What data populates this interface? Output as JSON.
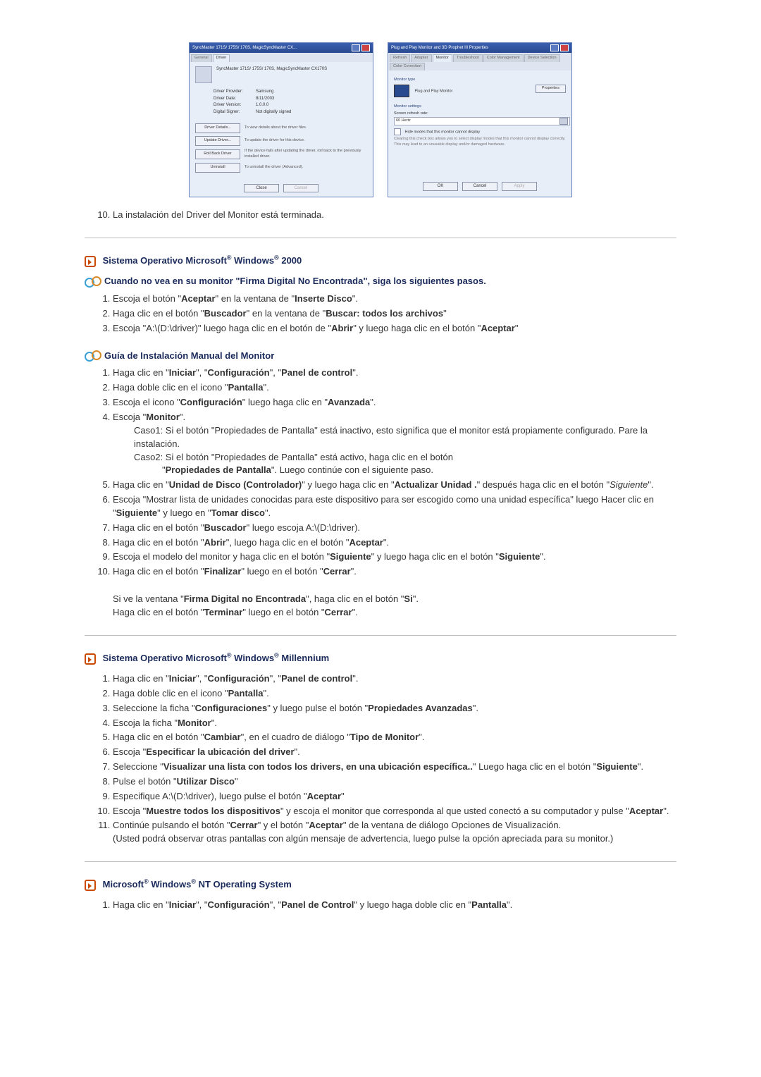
{
  "dialogs": {
    "driver": {
      "title": "SyncMaster 171S/ 175S/ 170S, MagicSyncMaster CX...",
      "tab_general": "General",
      "tab_driver": "Driver",
      "device_name": "SyncMaster 171S/ 175S/ 170S, MagicSyncMaster CX170S",
      "provider_label": "Driver Provider:",
      "provider_value": "Samsung",
      "date_label": "Driver Date:",
      "date_value": "8/11/2003",
      "version_label": "Driver Version:",
      "version_value": "1.0.0.0",
      "signer_label": "Digital Signer:",
      "signer_value": "Not digitally signed",
      "btn_details": "Driver Details...",
      "btn_details_desc": "To view details about the driver files.",
      "btn_update": "Update Driver...",
      "btn_update_desc": "To update the driver for this device.",
      "btn_rollback": "Roll Back Driver",
      "btn_rollback_desc": "If the device fails after updating the driver, roll back to the previously installed driver.",
      "btn_uninstall": "Uninstall",
      "btn_uninstall_desc": "To uninstall the driver (Advanced).",
      "footer_ok": "Close",
      "footer_cancel": "Cancel"
    },
    "pnp": {
      "title": "Plug and Play Monitor and 3D Prophet III Properties",
      "tabs": [
        "Refresh",
        "Adapter",
        "Monitor",
        "Troubleshoot",
        "Color Management",
        "Device Selection",
        "Color Correction"
      ],
      "section_type": "Monitor type",
      "monitor_name": "Plug and Play Monitor",
      "btn_properties": "Properties",
      "section_settings": "Monitor settings",
      "refresh_label": "Screen refresh rate:",
      "refresh_value": "60 Hertz",
      "chk_label": "Hide modes that this monitor cannot display",
      "note": "Clearing this check box allows you to select display modes that this monitor cannot display correctly. This may lead to an unusable display and/or damaged hardware.",
      "footer_ok": "OK",
      "footer_cancel": "Cancel",
      "footer_apply": "Apply"
    }
  },
  "step10": "La instalación del Driver del Monitor está terminada.",
  "sections": {
    "win2000": {
      "heading_pre": "Sistema Operativo Microsoft",
      "heading_mid": " Windows",
      "heading_post": " 2000",
      "sub1": "Cuando no vea en su monitor \"Firma Digital No Encontrada\", siga los siguientes pasos.",
      "s1_items": [
        "Escoja el botón \"<b>Aceptar</b>\" en la ventana de \"<b>Inserte Disco</b>\".",
        "Haga clic en el botón \"<b>Buscador</b>\" en la ventana de \"<b>Buscar: todos los archivos</b>\"",
        "Escoja \"A:\\(D:\\driver)\" luego haga clic en el botón de \"<b>Abrir</b>\" y luego haga clic en el botón \"<b>Aceptar</b>\""
      ],
      "sub2": "Guía de Instalación Manual del Monitor",
      "s2_items": [
        "Haga clic en \"<b>Iniciar</b>\", \"<b>Configuración</b>\", \"<b>Panel de control</b>\".",
        "Haga doble clic en el icono \"<b>Pantalla</b>\".",
        "Escoja el icono \"<b>Configuración</b>\" luego haga clic en \"<b>Avanzada</b>\".",
        "Escoja \"<b>Monitor</b>\".",
        "Haga clic en \"<b>Unidad de Disco (Controlador)</b>\" y luego haga clic en \"<b>Actualizar Unidad .</b>\" después haga clic en el botón \"<i>Siguiente</i>\".",
        "Escoja \"Mostrar lista de unidades conocidas para este dispositivo para ser escogido como una unidad específica\" luego Hacer clic en \"<b>Siguiente</b>\" y luego en \"<b>Tomar disco</b>\".",
        "Haga clic en el botón \"<b>Buscador</b>\" luego escoja A:\\(D:\\driver).",
        "Haga clic en el botón \"<b>Abrir</b>\", luego haga clic en el botón \"<b>Aceptar</b>\".",
        "Escoja el modelo del monitor y haga clic en el botón \"<b>Siguiente</b>\" y luego haga clic en el botón \"<b>Siguiente</b>\".",
        "Haga clic en el botón \"<b>Finalizar</b>\" luego en el botón \"<b>Cerrar</b>\"."
      ],
      "case1": "Caso1: Si el botón \"Propiedades de Pantalla\" está inactivo, esto significa que el monitor está propiamente configurado. Pare la instalación.",
      "case2_a": "Caso2: Si el botón \"Propiedades de Pantalla\" está activo, haga clic en el botón",
      "case2_b": "\"<b>Propiedades de Pantalla</b>\". Luego continúe con el siguiente paso.",
      "tail1": "Si ve la ventana \"<b>Firma Digital no Encontrada</b>\", haga clic en el botón \"<b>Si</b>\".",
      "tail2": "Haga clic en el botón \"<b>Terminar</b>\" luego en el botón \"<b>Cerrar</b>\"."
    },
    "winme": {
      "heading_pre": "Sistema Operativo Microsoft",
      "heading_mid": " Windows",
      "heading_post": " Millennium",
      "items": [
        "Haga clic en \"<b>Iniciar</b>\", \"<b>Configuración</b>\", \"<b>Panel de control</b>\".",
        "Haga doble clic en el icono \"<b>Pantalla</b>\".",
        "Seleccione la ficha \"<b>Configuraciones</b>\" y luego pulse el botón \"<b>Propiedades Avanzadas</b>\".",
        "Escoja la ficha \"<b>Monitor</b>\".",
        "Haga clic en el botón \"<b>Cambiar</b>\", en el cuadro de diálogo \"<b>Tipo de Monitor</b>\".",
        "Escoja \"<b>Especificar la ubicación del driver</b>\".",
        "Seleccione \"<b>Visualizar una lista con todos los drivers, en una ubicación específica..</b>\" Luego haga clic en el botón \"<b>Siguiente</b>\".",
        "Pulse el botón \"<b>Utilizar Disco</b>\"",
        "Especifique A:\\(D:\\driver), luego pulse el botón \"<b>Aceptar</b>\"",
        "Escoja \"<b>Muestre todos los dispositivos</b>\" y escoja el monitor que corresponda al que usted conectó a su computador y pulse \"<b>Aceptar</b>\".",
        "Continúe pulsando el botón \"<b>Cerrar</b>\" y el botón \"<b>Aceptar</b>\" de la ventana de diálogo Opciones de Visualización.<br>(Usted podrá observar otras pantallas con algún mensaje de advertencia, luego pulse la opción apreciada para su monitor.)"
      ]
    },
    "winnt": {
      "heading_pre": "Microsoft",
      "heading_mid": " Windows",
      "heading_post": " NT Operating System",
      "items": [
        "Haga clic en \"<b>Iniciar</b>\", \"<b>Configuración</b>\", \"<b>Panel de Control</b>\" y luego haga doble clic en \"<b>Pantalla</b>\"."
      ]
    }
  }
}
